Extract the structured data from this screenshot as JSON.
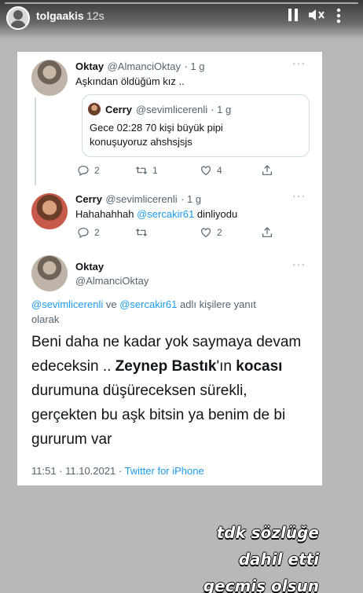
{
  "story": {
    "username": "tolgaakis",
    "time": "12s",
    "icons": [
      "pause-icon",
      "mute-icon",
      "more-icon"
    ]
  },
  "tweet1": {
    "name": "Oktay",
    "handle": "@AlmanciOktay",
    "time": "· 1 g",
    "text": "Aşkından öldüğüm kız ..",
    "quote": {
      "name": "Cerry",
      "handle": "@sevimlicerenli",
      "time": "· 1 g",
      "text_line1": "Gece 02:28 70 kişi büyük pipi",
      "text_line2": "konuşuyoruz ahshsjsjs"
    },
    "replies": "2",
    "retweets": "1",
    "likes": "4"
  },
  "tweet2": {
    "name": "Cerry",
    "handle": "@sevimlicerenli",
    "time": "· 1 g",
    "text_prefix": "Hahahahhah",
    "mention": "@sercakir61",
    "text_suffix": "dinliyodu",
    "replies": "2",
    "likes": "2"
  },
  "tweet3": {
    "name": "Oktay",
    "handle": "@AlmanciOktay",
    "reply_mention1": "@sevimlicerenli",
    "reply_and": "ve",
    "reply_mention2": "@sercakir61",
    "reply_suffix": "adlı kişilere yanıt",
    "reply_suffix2": "olarak",
    "body_part1": "Beni daha ne kadar yok saymaya devam edeceksin .. ",
    "body_bold1": "Zeynep Bastık",
    "body_part2": "'ın ",
    "body_bold2": "kocası",
    "body_part3": " durumuna düşüreceksen sürekli, gerçekten bu aşk bitsin ya benim de bi gururum var",
    "timestamp": "11:51 · 11.10.2021 ·",
    "source": "Twitter for iPhone"
  },
  "captions": {
    "line1": "tdk sözlüğe",
    "line2": "dahil etti",
    "line3": "gecmiş olsun"
  }
}
